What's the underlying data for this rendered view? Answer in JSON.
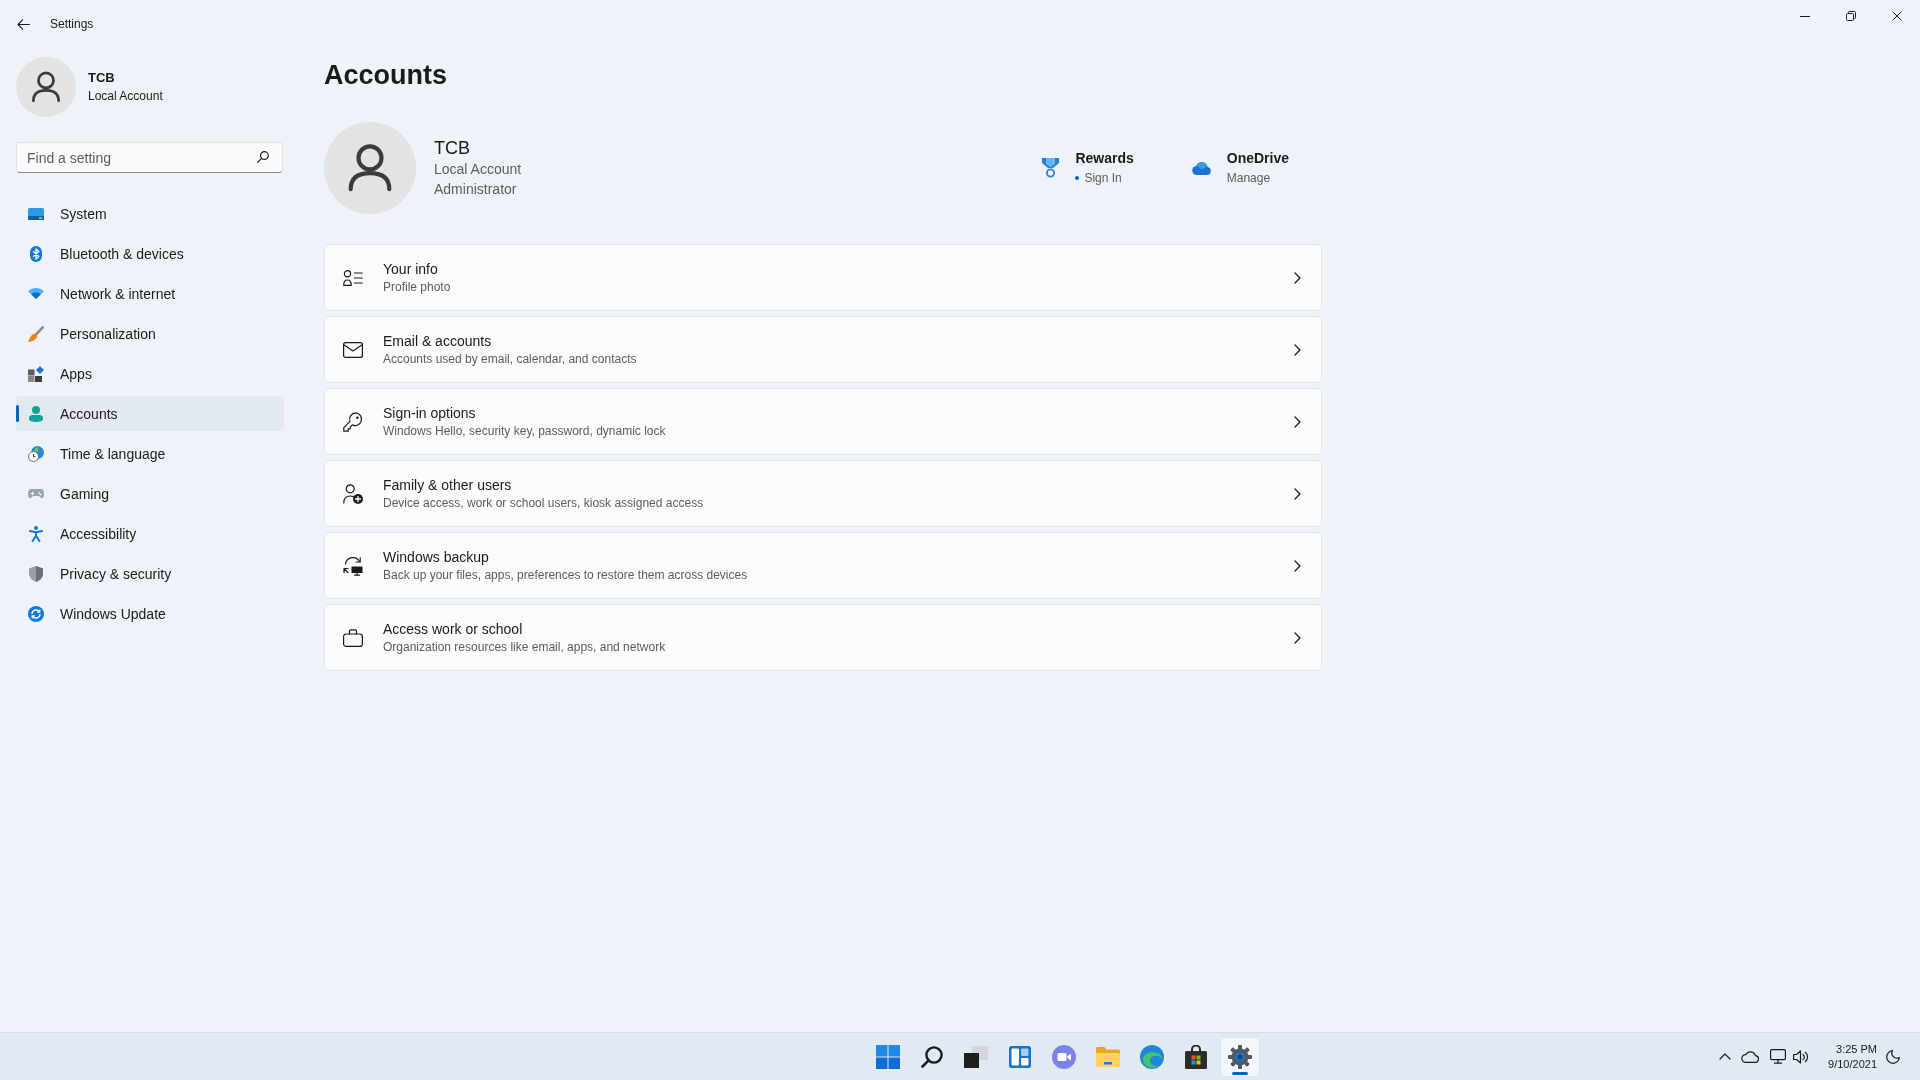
{
  "window": {
    "title": "Settings"
  },
  "profile": {
    "name": "TCB",
    "account_type": "Local Account"
  },
  "search": {
    "placeholder": "Find a setting"
  },
  "sidebar": {
    "items": [
      {
        "label": "System",
        "selected": false
      },
      {
        "label": "Bluetooth & devices",
        "selected": false
      },
      {
        "label": "Network & internet",
        "selected": false
      },
      {
        "label": "Personalization",
        "selected": false
      },
      {
        "label": "Apps",
        "selected": false
      },
      {
        "label": "Accounts",
        "selected": true
      },
      {
        "label": "Time & language",
        "selected": false
      },
      {
        "label": "Gaming",
        "selected": false
      },
      {
        "label": "Accessibility",
        "selected": false
      },
      {
        "label": "Privacy & security",
        "selected": false
      },
      {
        "label": "Windows Update",
        "selected": false
      }
    ]
  },
  "page": {
    "title": "Accounts"
  },
  "account": {
    "name": "TCB",
    "details": [
      "Local Account",
      "Administrator"
    ]
  },
  "services": [
    {
      "name": "Rewards",
      "action": "Sign In",
      "attention": true
    },
    {
      "name": "OneDrive",
      "action": "Manage",
      "attention": false
    }
  ],
  "settings": [
    {
      "title": "Your info",
      "description": "Profile photo"
    },
    {
      "title": "Email & accounts",
      "description": "Accounts used by email, calendar, and contacts"
    },
    {
      "title": "Sign-in options",
      "description": "Windows Hello, security key, password, dynamic lock"
    },
    {
      "title": "Family & other users",
      "description": "Device access, work or school users, kiosk assigned access"
    },
    {
      "title": "Windows backup",
      "description": "Back up your files, apps, preferences to restore them across devices"
    },
    {
      "title": "Access work or school",
      "description": "Organization resources like email, apps, and network"
    }
  ],
  "taskbar": {
    "apps": [
      {
        "selected": false
      },
      {
        "selected": false
      },
      {
        "selected": false
      },
      {
        "selected": false
      },
      {
        "selected": false
      },
      {
        "selected": false
      },
      {
        "selected": false
      },
      {
        "selected": false
      },
      {
        "selected": true
      }
    ],
    "clock": {
      "time": "3:25 PM",
      "date": "9/10/2021"
    }
  }
}
